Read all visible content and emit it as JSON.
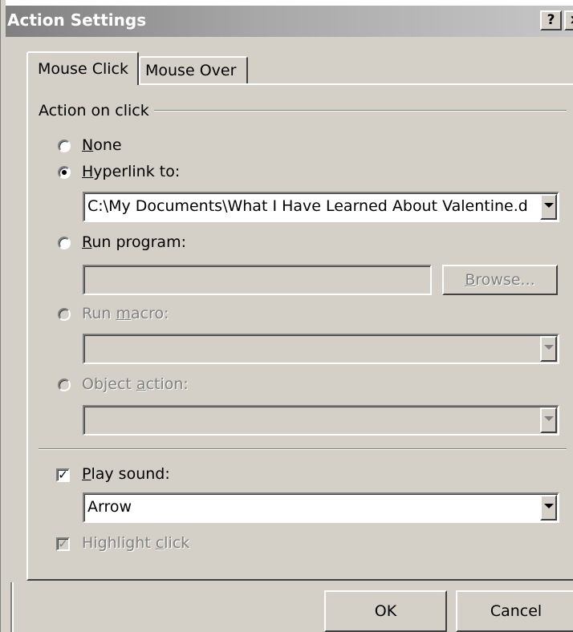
{
  "window": {
    "title": "Action Settings",
    "help_label": "?",
    "close_label": "×"
  },
  "tabs": [
    {
      "label": "Mouse Click",
      "selected": true
    },
    {
      "label": "Mouse Over",
      "selected": false
    }
  ],
  "action_group": {
    "label": "Action on click",
    "options": {
      "none": {
        "prefix": "",
        "accel": "N",
        "rest": "one",
        "checked": false,
        "enabled": true
      },
      "hyperlink": {
        "prefix": "",
        "accel": "H",
        "rest": "yperlink to:",
        "checked": true,
        "enabled": true
      },
      "run_program": {
        "prefix": "",
        "accel": "R",
        "rest": "un program:",
        "checked": false,
        "enabled": true
      },
      "run_macro": {
        "prefix": "Run ",
        "accel": "m",
        "rest": "acro:",
        "checked": false,
        "enabled": false
      },
      "object_action": {
        "prefix": "Object ",
        "accel": "a",
        "rest": "ction:",
        "checked": false,
        "enabled": false
      }
    },
    "hyperlink_value": "C:\\My Documents\\What I Have Learned About Valentine.d",
    "run_program_value": "",
    "browse_button": {
      "accel": "B",
      "rest": "rowse..."
    },
    "run_macro_value": "",
    "object_action_value": ""
  },
  "sound": {
    "play_sound": {
      "accel": "P",
      "rest": "lay sound:",
      "checked": true
    },
    "sound_value": "Arrow",
    "highlight_click": {
      "prefix": "Highlight ",
      "accel": "c",
      "rest": "lick",
      "checked": true,
      "enabled": false
    }
  },
  "footer": {
    "ok_label": "OK",
    "cancel_label": "Cancel"
  }
}
